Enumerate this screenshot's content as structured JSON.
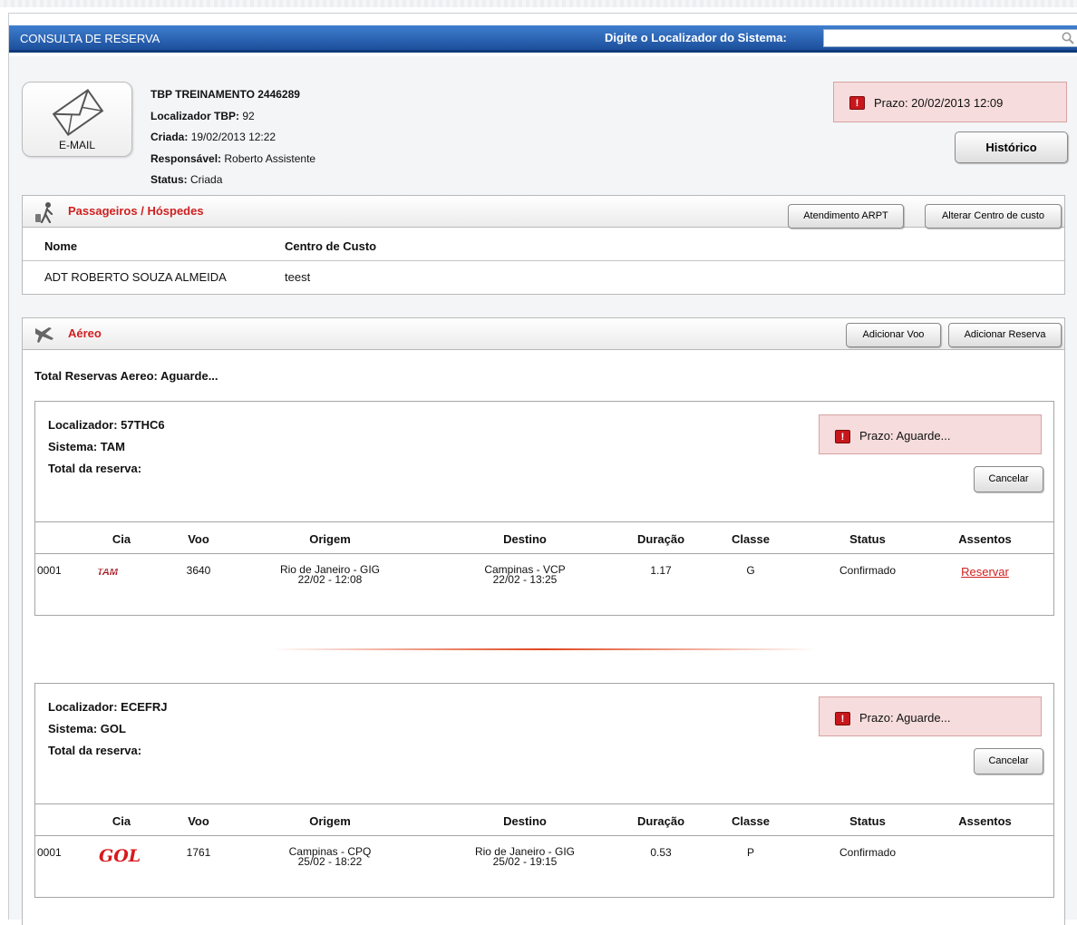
{
  "header": {
    "title": "CONSULTA DE RESERVA",
    "search_label": "Digite o Localizador do Sistema:",
    "search_value": "",
    "search_placeholder": ""
  },
  "email_button": {
    "label": "E-MAIL"
  },
  "booking": {
    "name": "TBP TREINAMENTO 2446289",
    "localizador_label": "Localizador TBP:",
    "localizador_value": "92",
    "criada_label": "Criada:",
    "criada_value": "19/02/2013 12:22",
    "responsavel_label": "Responsável:",
    "responsavel_value": "Roberto Assistente",
    "status_label": "Status:",
    "status_value": "Criada"
  },
  "prazo_main": "Prazo: 20/02/2013 12:09",
  "historico_button": "Histórico",
  "passengers": {
    "title": "Passageiros / Hóspedes",
    "btn_atendimento": "Atendimento ARPT",
    "btn_alterar": "Alterar Centro de custo",
    "col_nome": "Nome",
    "col_centro": "Centro de Custo",
    "rows": [
      {
        "nome": "ADT ROBERTO SOUZA ALMEIDA",
        "centro": "teest"
      }
    ]
  },
  "aereo": {
    "title": "Aéreo",
    "btn_adicionar_voo": "Adicionar Voo",
    "btn_adicionar_reserva": "Adicionar Reserva",
    "total_text": "Total Reservas Aereo: Aguarde...",
    "columns": [
      "Cia",
      "Voo",
      "Origem",
      "Destino",
      "Duração",
      "Classe",
      "Status",
      "Assentos"
    ],
    "reservations": [
      {
        "localizador": "Localizador: 57THC6",
        "sistema": "Sistema: TAM",
        "total": "Total da reserva:",
        "prazo": "Prazo: Aguarde...",
        "cancel": "Cancelar",
        "flight": {
          "seq": "0001",
          "cia": "TAM",
          "voo": "3640",
          "origem_city": "Rio de Janeiro - GIG",
          "origem_time": "22/02 - 12:08",
          "destino_city": "Campinas - VCP",
          "destino_time": "22/02 - 13:25",
          "duracao": "1.17",
          "classe": "G",
          "status": "Confirmado",
          "assentos": "Reservar"
        }
      },
      {
        "localizador": "Localizador: ECEFRJ",
        "sistema": "Sistema: GOL",
        "total": "Total da reserva:",
        "prazo": "Prazo: Aguarde...",
        "cancel": "Cancelar",
        "flight": {
          "seq": "0001",
          "cia": "GOL",
          "voo": "1761",
          "origem_city": "Campinas - CPQ",
          "origem_time": "25/02 - 18:22",
          "destino_city": "Rio de Janeiro - GIG",
          "destino_time": "25/02 - 19:15",
          "duracao": "0.53",
          "classe": "P",
          "status": "Confirmado",
          "assentos": ""
        }
      }
    ]
  },
  "colors": {
    "titlebar": "#1c4f9c",
    "accent_red": "#d01f1f",
    "prazo_bg": "#f6dcdc"
  }
}
